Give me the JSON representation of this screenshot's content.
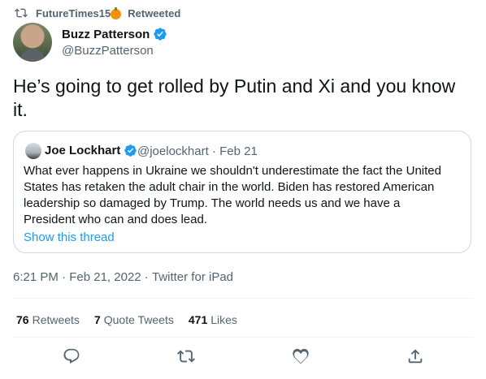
{
  "retweet_banner": {
    "user": "FutureTimes15",
    "label": "Retweeted"
  },
  "author": {
    "name": "Buzz Patterson",
    "handle": "@BuzzPatterson"
  },
  "tweet": {
    "text": "He’s going to get rolled by Putin and Xi and you know it."
  },
  "quoted": {
    "name": "Joe Lockhart",
    "handle": "@joelockhart",
    "separator": " · ",
    "date": "Feb 21",
    "text": "What ever happens in Ukraine we shouldn't underestimate the fact the United States has retaken the adult chair in the world. Biden has restored American leadership so damaged by Trump. The world needs us and we have a President who can and does lead.",
    "show_thread": "Show this thread"
  },
  "meta": {
    "time": "6:21 PM",
    "sep": " · ",
    "date": "Feb 21, 2022",
    "source": "Twitter for iPad"
  },
  "stats": {
    "retweets": {
      "count": "76",
      "label": "Retweets"
    },
    "quotes": {
      "count": "7",
      "label": "Quote Tweets"
    },
    "likes": {
      "count": "471",
      "label": "Likes"
    }
  },
  "icons": [
    "retweet-icon",
    "verified-icon",
    "reply-icon",
    "like-icon",
    "share-icon"
  ],
  "colors": {
    "accent": "#1d9bf0",
    "secondary_text": "#536471",
    "border": "#cfd9de"
  }
}
